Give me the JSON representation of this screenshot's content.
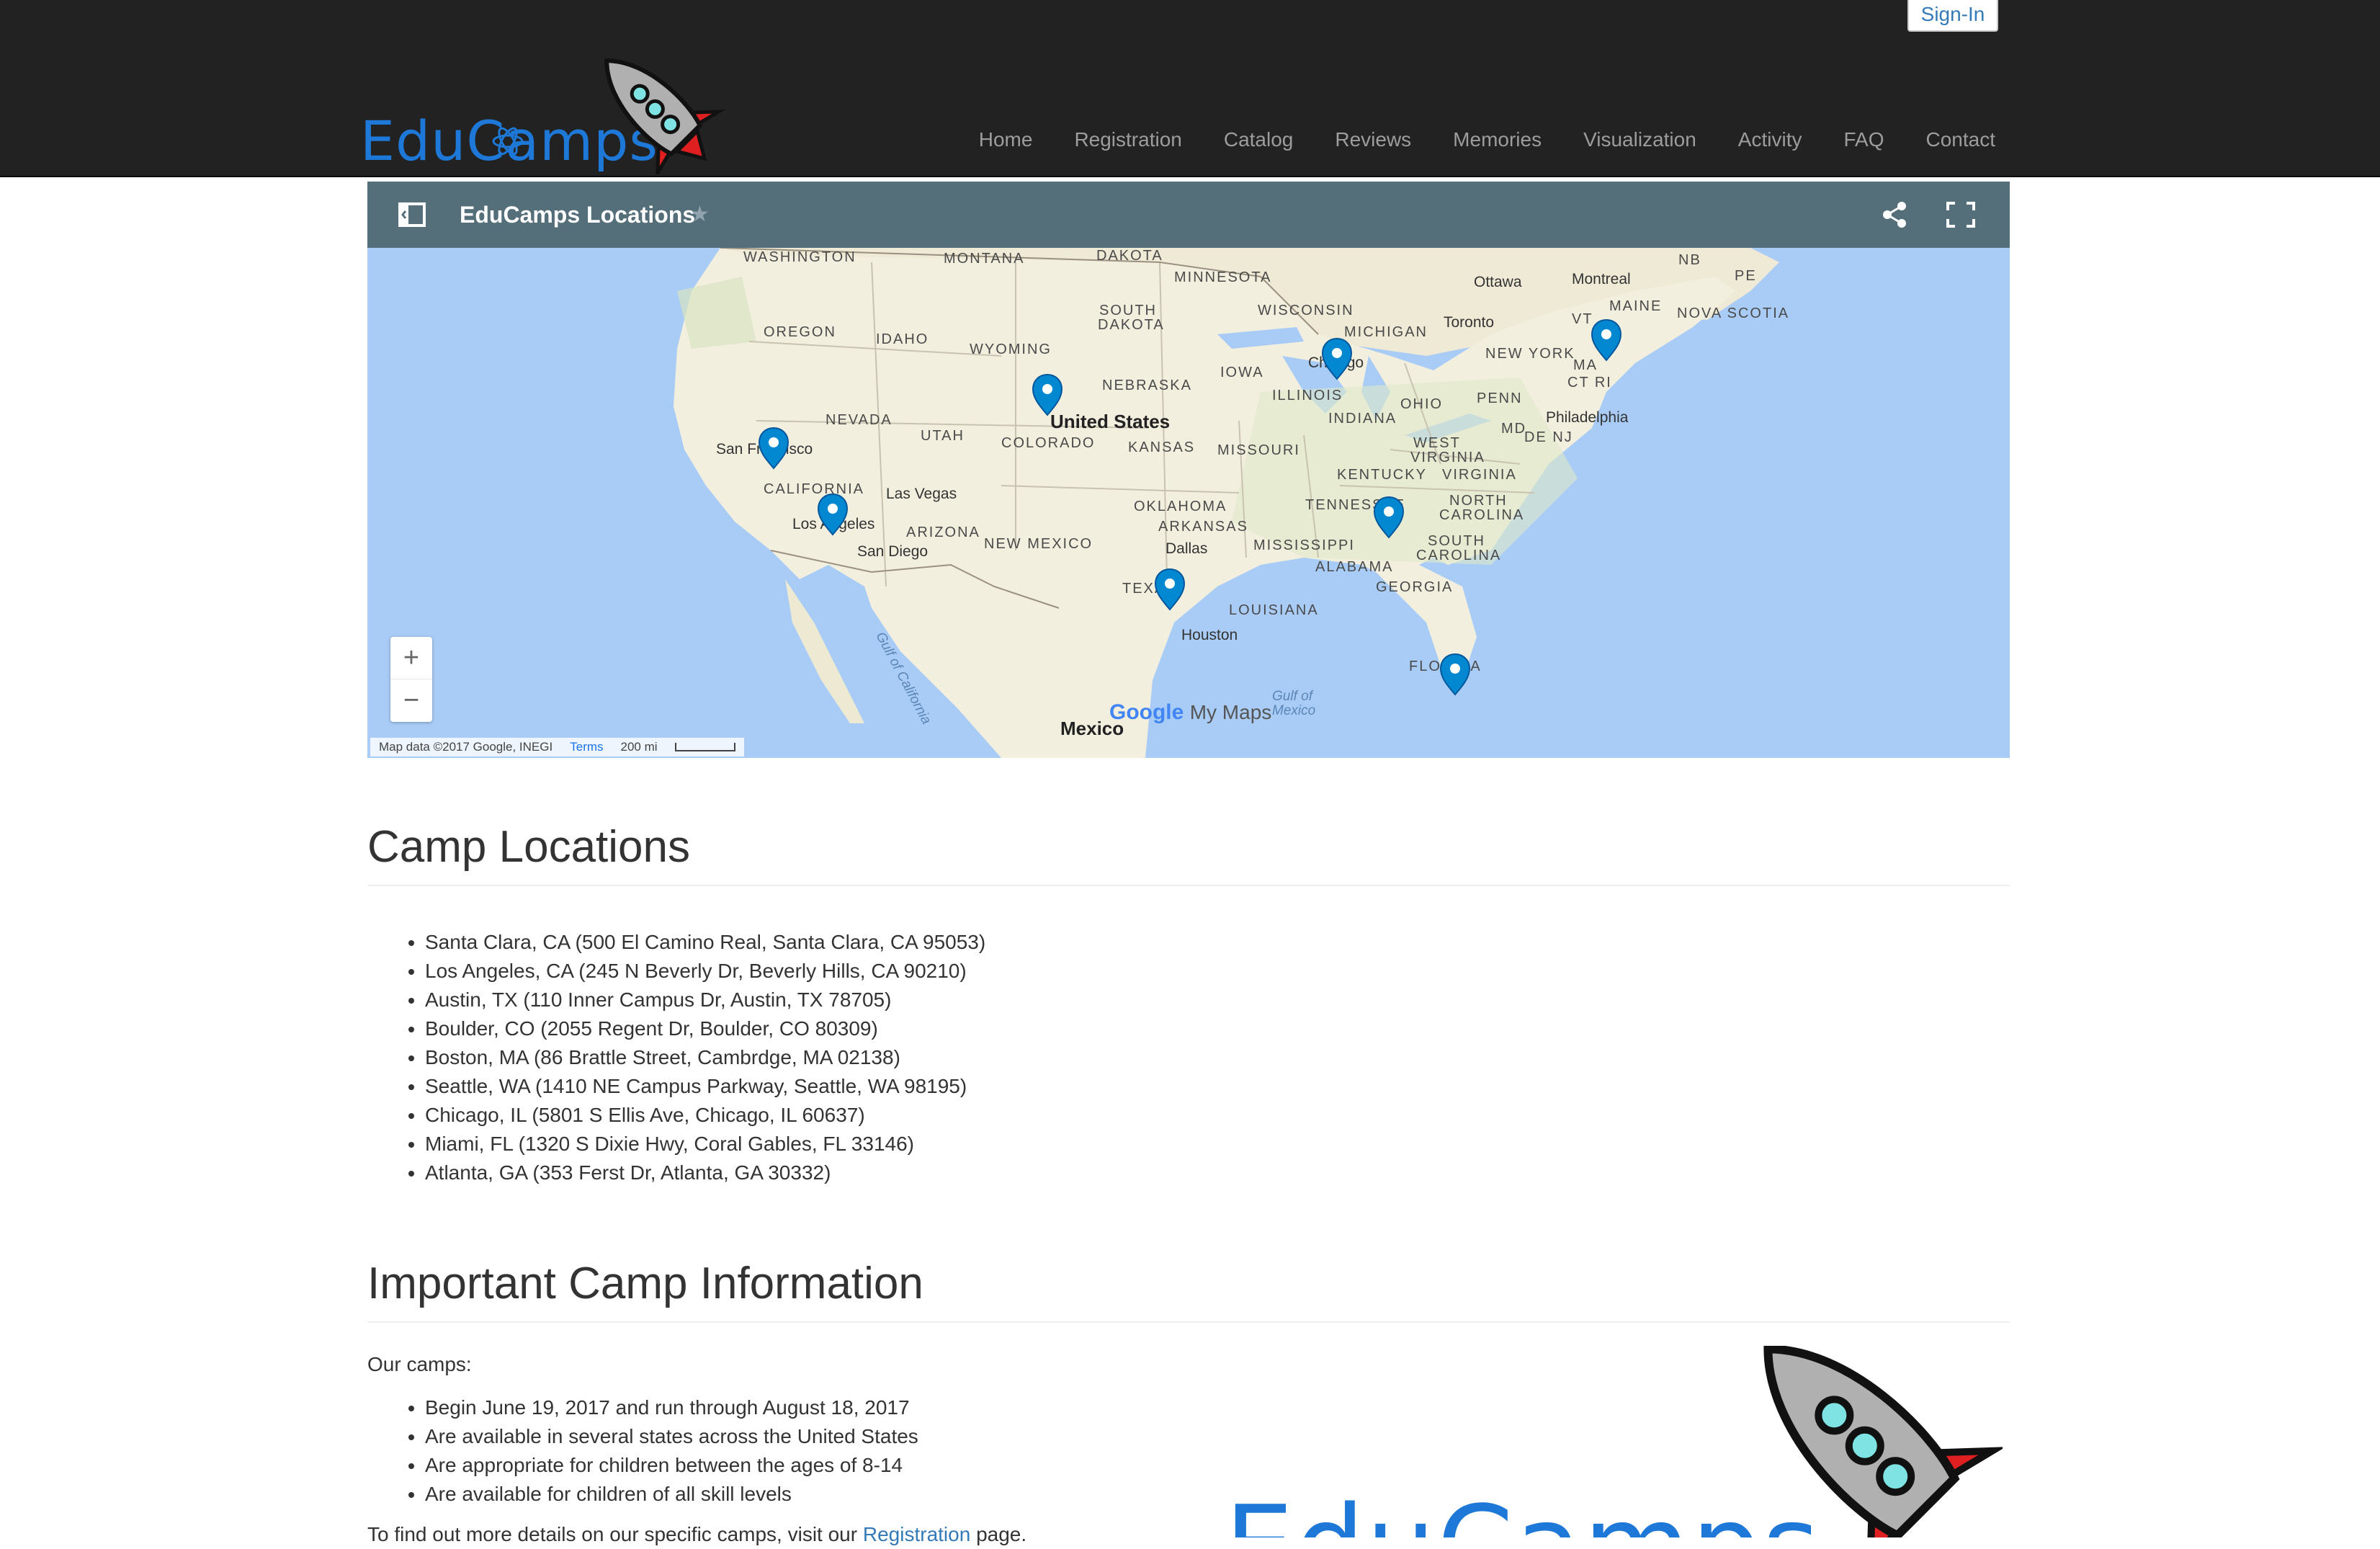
{
  "header": {
    "sign_in": "Sign-In",
    "logo_text": "EduCamps",
    "nav": [
      "Home",
      "Registration",
      "Catalog",
      "Reviews",
      "Memories",
      "Visualization",
      "Activity",
      "FAQ",
      "Contact"
    ]
  },
  "map": {
    "title": "EduCamps Locations",
    "zoom_in": "+",
    "zoom_out": "−",
    "attribution": "Map data ©2017 Google, INEGI",
    "terms": "Terms",
    "scale": "200 mi",
    "google": "Google",
    "my_maps": "My Maps",
    "labels": {
      "washington": "WASHINGTON",
      "montana": "MONTANA",
      "dakota": "DAKOTA",
      "minnesota": "MINNESOTA",
      "ottawa": "Ottawa",
      "montreal": "Montreal",
      "nb": "NB",
      "pe": "PE",
      "oregon": "OREGON",
      "idaho": "IDAHO",
      "wyoming": "WYOMING",
      "south_dakota_1": "SOUTH",
      "south_dakota_2": "DAKOTA",
      "wisconsin": "WISCONSIN",
      "michigan": "MICHIGAN",
      "toronto": "Toronto",
      "maine": "MAINE",
      "nova_scotia": "NOVA SCOTIA",
      "vt": "VT",
      "new_york": "NEW YORK",
      "ma": "MA",
      "ct_ri": "CT RI",
      "iowa": "IOWA",
      "nebraska": "NEBRASKA",
      "chicago": "Chicago",
      "illinois": "ILLINOIS",
      "ohio": "OHIO",
      "penn": "PENN",
      "nevada": "NEVADA",
      "utah": "UTAH",
      "united_states": "United States",
      "colorado": "COLORADO",
      "kansas": "KANSAS",
      "missouri": "MISSOURI",
      "indiana": "INDIANA",
      "md": "MD",
      "de_nj": "DE NJ",
      "philadelphia": "Philadelphia",
      "san_francisco": "San Francisco",
      "west_virginia_1": "WEST",
      "west_virginia_2": "VIRGINIA",
      "virginia": "VIRGINIA",
      "kentucky": "KENTUCKY",
      "california": "CALIFORNIA",
      "las_vegas": "Las Vegas",
      "oklahoma": "OKLAHOMA",
      "tennessee": "TENNESSEE",
      "north_carolina_1": "NORTH",
      "north_carolina_2": "CAROLINA",
      "los_angeles": "Los Angeles",
      "arizona": "ARIZONA",
      "arkansas": "ARKANSAS",
      "new_mexico": "NEW MEXICO",
      "mississippi": "MISSISSIPPI",
      "south_carolina_1": "SOUTH",
      "south_carolina_2": "CAROLINA",
      "san_diego": "San Diego",
      "dallas": "Dallas",
      "alabama": "ALABAMA",
      "georgia": "GEORGIA",
      "texas": "TEXAS",
      "louisiana": "LOUISIANA",
      "houston": "Houston",
      "florida": "FLORIDA",
      "gulf_of_california": "Gulf of California",
      "gulf_of_mexico_1": "Gulf of",
      "gulf_of_mexico_2": "Mexico",
      "mexico": "Mexico"
    }
  },
  "locations_title": "Camp Locations",
  "locations": [
    "Santa Clara, CA (500 El Camino Real, Santa Clara, CA 95053)",
    "Los Angeles, CA (245 N Beverly Dr, Beverly Hills, CA 90210)",
    "Austin, TX (110 Inner Campus Dr, Austin, TX 78705)",
    "Boulder, CO (2055 Regent Dr, Boulder, CO 80309)",
    "Boston, MA (86 Brattle Street, Cambrdge, MA 02138)",
    "Seattle, WA (1410 NE Campus Parkway, Seattle, WA 98195)",
    "Chicago, IL (5801 S Ellis Ave, Chicago, IL 60637)",
    "Miami, FL (1320 S Dixie Hwy, Coral Gables, FL 33146)",
    "Atlanta, GA (353 Ferst Dr, Atlanta, GA 30332)"
  ],
  "info_title": "Important Camp Information",
  "info_intro": "Our camps:",
  "info_items": [
    "Begin June 19, 2017 and run through August 18, 2017",
    "Are available in several states across the United States",
    "Are appropriate for children between the ages of 8-14",
    "Are available for children of all skill levels"
  ],
  "details_prefix": "To find out more details on our specific camps, visit our",
  "details_link": "Registration",
  "details_suffix": "page.",
  "big_logo_text": "EduCamps",
  "colors": {
    "header_bg": "#222222",
    "nav_text": "#9d9d9d",
    "brand_blue": "#1e78d7",
    "map_header": "#546e7a",
    "water": "#a8ccf6",
    "land": "#f2efe0",
    "pin": "#0288d1",
    "link": "#337ab7"
  }
}
